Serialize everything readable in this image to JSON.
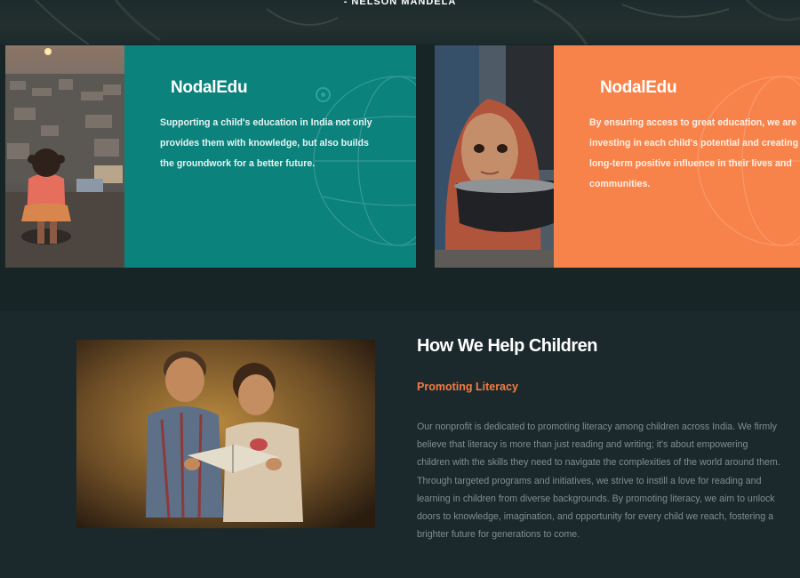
{
  "banner": {
    "quote_author": "- NELSON MANDELA"
  },
  "cards": [
    {
      "brand": "NodalEdu",
      "text": "Supporting a child's education in India not only provides them with knowledge, but also builds the groundwork for a better future.",
      "photo": "girl sitting overlooking slum at sunset",
      "panel_color": "#0b827c"
    },
    {
      "brand": "NodalEdu",
      "text": "By ensuring access to great education, we are investing in each child's potential and creating a long-term positive influence in their lives and communities.",
      "photo": "girl in red headscarf holding a bowl",
      "panel_color": "#f8834a"
    }
  ],
  "help": {
    "title": "How We Help Children",
    "subtitle": "Promoting Literacy",
    "body": "Our nonprofit is dedicated to promoting literacy among children across India. We firmly believe that literacy is more than just reading and writing; it's about empowering children with the skills they need to navigate the complexities of the world around them. Through targeted programs and initiatives, we strive to instill a love for reading and learning in children from diverse backgrounds. By promoting literacy, we aim to unlock doors to knowledge, imagination, and opportunity for every child we reach, fostering a brighter future for generations to come.",
    "photo": "two children reading a book together"
  },
  "colors": {
    "accent_teal": "#0b827c",
    "accent_orange": "#f8834a",
    "subtitle_orange": "#f47c43",
    "background": "#1c2a2d"
  }
}
